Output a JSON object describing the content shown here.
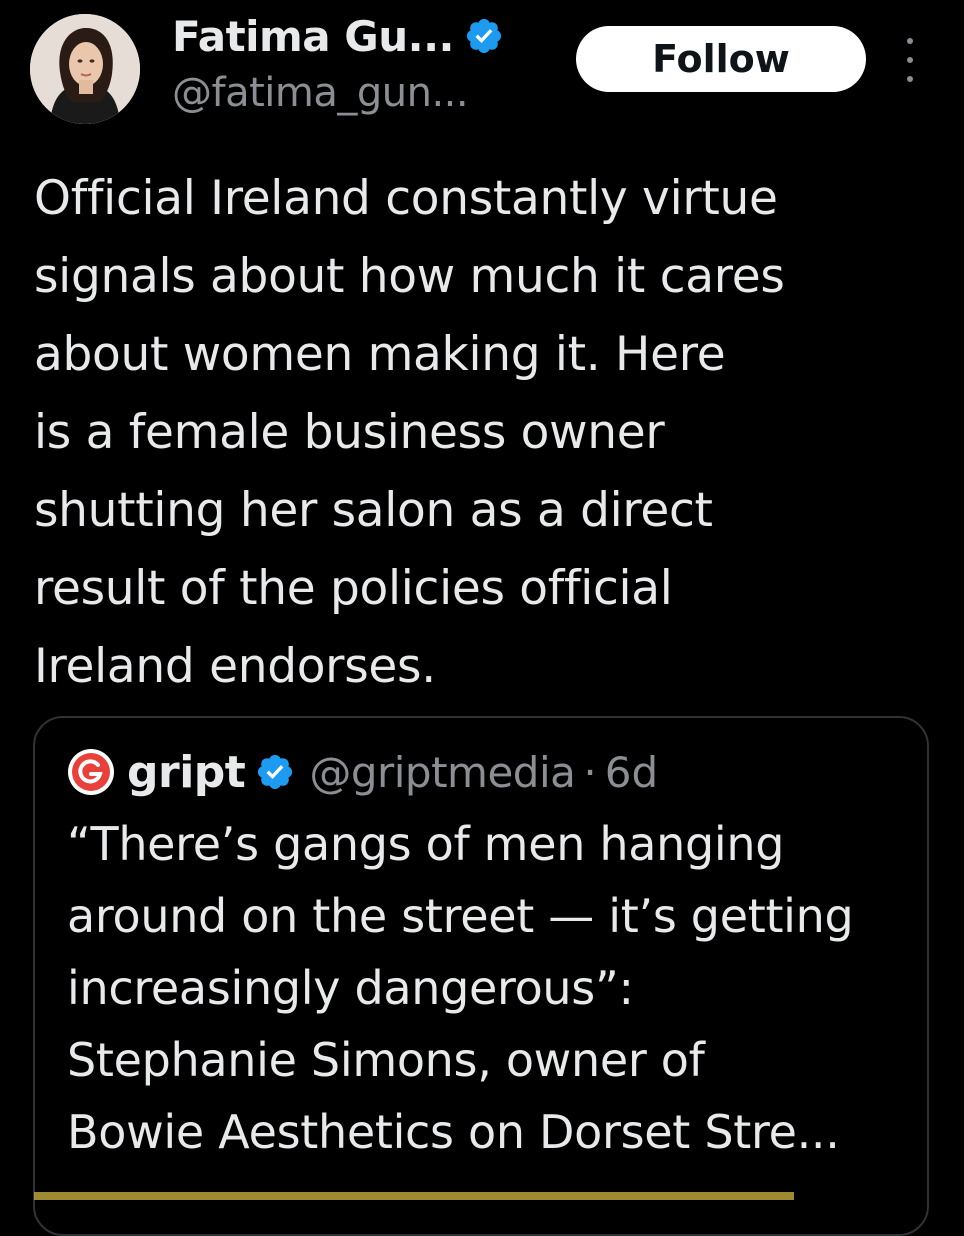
{
  "tweet": {
    "author": {
      "display_name": "Fatima Gu...",
      "handle": "@fatima_gun...",
      "verified_icon": "verified-badge-icon",
      "verified_color": "#1d9bf0"
    },
    "follow_label": "Follow",
    "more_icon": "more-vertical-icon",
    "text": "Official Ireland constantly virtue\nsignals about how much it cares\nabout women making it. Here\nis a female business owner\nshutting her salon as a direct\nresult of the policies official\nIreland endorses."
  },
  "quote": {
    "logo_icon": "gript-logo-icon",
    "logo_color": "#e8413c",
    "name": "gript",
    "handle": "@griptmedia",
    "separator": "·",
    "time": "6d",
    "text": "“There’s gangs of men hanging\naround on the street — it’s getting\nincreasingly dangerous”:\nStephanie Simons, owner of\nBowie Aesthetics on Dorset Stre..."
  },
  "colors": {
    "background": "#000000",
    "text_primary": "#e7e9ea",
    "text_secondary": "#8b8f94",
    "follow_button_bg": "#ffffff",
    "border": "#2f3336"
  }
}
